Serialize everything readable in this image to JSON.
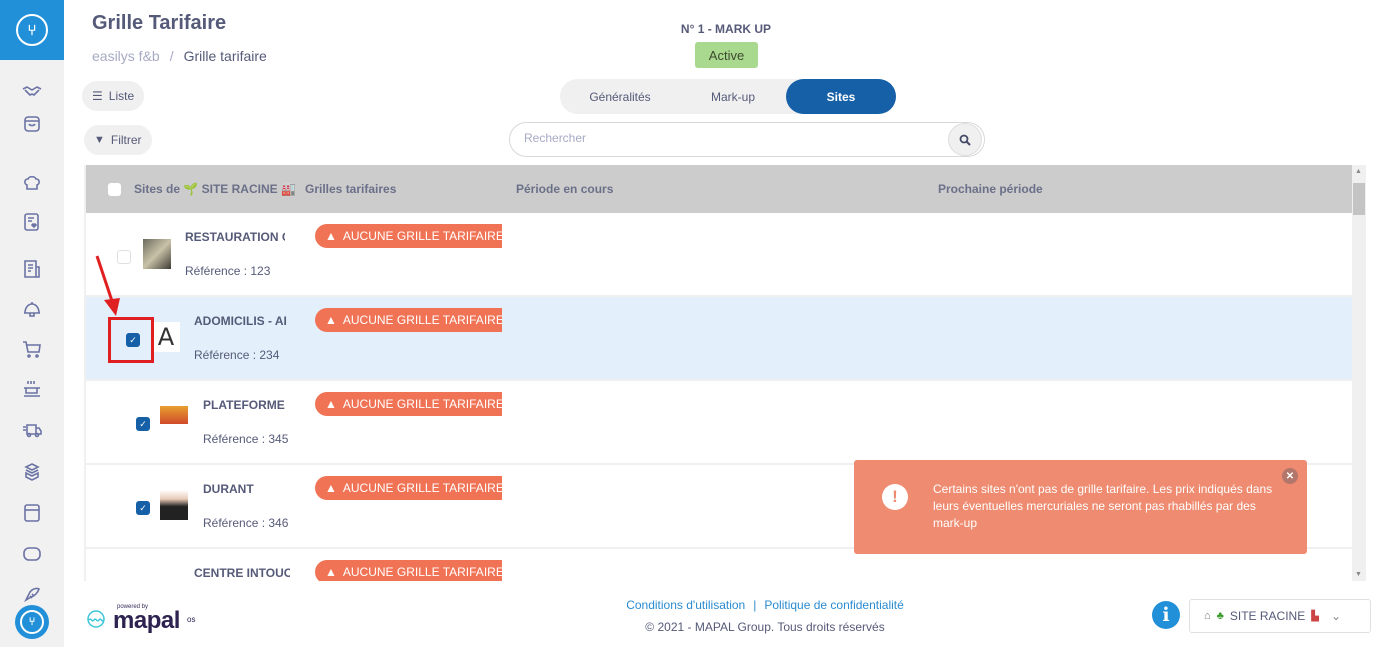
{
  "sidebar": {
    "items": [
      {
        "icon": "handshake-icon"
      },
      {
        "icon": "shopping-bag-icon"
      },
      {
        "icon": "chef-hat-icon"
      },
      {
        "icon": "favorites-list-icon"
      },
      {
        "icon": "invoice-icon"
      },
      {
        "icon": "cloche-icon"
      },
      {
        "icon": "cart-icon"
      },
      {
        "icon": "cooking-pan-icon"
      },
      {
        "icon": "delivery-truck-icon"
      },
      {
        "icon": "stock-boxes-icon"
      },
      {
        "icon": "calculator-icon"
      },
      {
        "icon": "chat-icon"
      },
      {
        "icon": "fish-icon"
      }
    ]
  },
  "header": {
    "title": "Grille Tarifaire",
    "breadcrumb": {
      "root": "easilys f&b",
      "separator": "/",
      "current": "Grille tarifaire"
    },
    "list_button": "Liste",
    "filter_button": "Filtrer",
    "markup_label": "N° 1 - MARK UP",
    "status_badge": "Active"
  },
  "tabs": [
    {
      "label": "Généralités",
      "active": false
    },
    {
      "label": "Mark-up",
      "active": false
    },
    {
      "label": "Sites",
      "active": true
    }
  ],
  "search": {
    "placeholder": "Rechercher",
    "value": ""
  },
  "table": {
    "columns": [
      "Sites de 🌱 SITE RACINE 🏭",
      "Grilles tarifaires",
      "Période en cours",
      "Prochaine période"
    ],
    "rows": [
      {
        "name": "RESTAURATION C",
        "reference": "Référence : 123",
        "grid": "AUCUNE GRILLE TARIFAIRE",
        "checked": false,
        "selected": false
      },
      {
        "name": "ADOMICILIS - AI",
        "reference": "Référence : 234",
        "grid": "AUCUNE GRILLE TARIFAIRE",
        "checked": true,
        "selected": true
      },
      {
        "name": "PLATEFORME",
        "reference": "Référence : 345",
        "grid": "AUCUNE GRILLE TARIFAIRE",
        "checked": true,
        "selected": false
      },
      {
        "name": "DURANT",
        "reference": "Référence : 346",
        "grid": "AUCUNE GRILLE TARIFAIRE",
        "checked": true,
        "selected": false
      },
      {
        "name": "CENTRE INTOUC",
        "reference": "",
        "grid": "AUCUNE GRILLE TARIFAIRE",
        "checked": false,
        "selected": false
      }
    ]
  },
  "toast": {
    "message": "Certains sites n'ont pas de grille tarifaire. Les prix indiqués dans leurs éventuelles mercuriales ne seront pas rhabillés par des mark-up",
    "color": "#ee8b70"
  },
  "footer": {
    "powered_by": "powered by",
    "brand": "mapal",
    "brand_suffix": "os",
    "terms_link": "Conditions d'utilisation",
    "link_separator": "|",
    "privacy_link": "Politique de confidentialité",
    "copyright": "© 2021 - MAPAL Group. Tous droits réservés",
    "site_selector": "SITE RACINE"
  },
  "colors": {
    "primary": "#1560a7",
    "sidebar_accent": "#2190d8",
    "warning": "#f07355",
    "active_badge": "#a8d98f"
  }
}
